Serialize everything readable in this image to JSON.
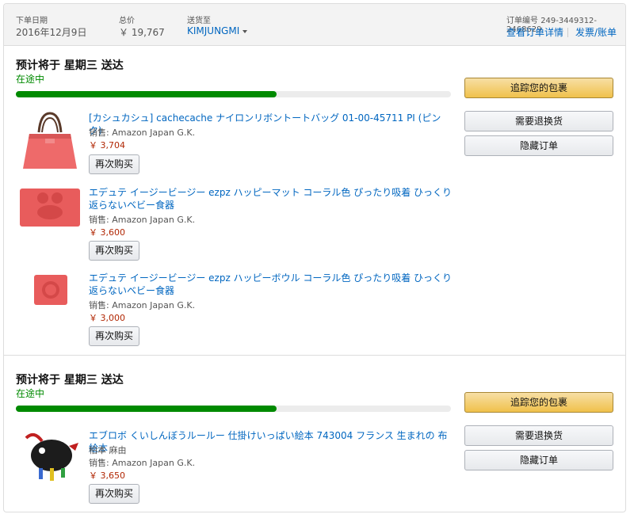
{
  "header": {
    "order_date_label": "下单日期",
    "order_date": "2016年12月9日",
    "total_label": "总价",
    "total": "￥ 19,767",
    "ship_to_label": "送货至",
    "ship_to": "KIMJUNGMI",
    "order_number_label": "订单编号",
    "order_number": "249-3449312-2468629",
    "view_details": "查看订单详情",
    "invoice": "发票/账单"
  },
  "shipments": [
    {
      "title": "预计将于 星期三 送达",
      "status": "在途中",
      "progress": 0.6,
      "track_button": "追踪您的包裹",
      "return_button": "需要退换货",
      "hide_button": "隐藏订单",
      "items": [
        {
          "title": "[カシュカシュ] cachecache ナイロンリボントートバッグ 01-00-45711 PI (ピンク)",
          "seller": "销售: Amazon Japan G.K.",
          "price": "￥ 3,704",
          "buy_again": "再次购买",
          "icon": "tote-bag-image"
        },
        {
          "title": "エデュテ イージービージー ezpz ハッピーマット コーラル色 ぴったり吸着 ひっくり返らないベビー食器",
          "seller": "销售: Amazon Japan G.K.",
          "price": "￥ 3,600",
          "buy_again": "再次购买",
          "icon": "happy-mat-image"
        },
        {
          "title": "エデュテ イージービージー ezpz ハッピーボウル コーラル色 ぴったり吸着 ひっくり返らないベビー食器",
          "seller": "销售: Amazon Japan G.K.",
          "price": "￥ 3,000",
          "buy_again": "再次购买",
          "icon": "happy-bowl-image"
        }
      ]
    },
    {
      "title": "预计将于 星期三 送达",
      "status": "在途中",
      "progress": 0.6,
      "track_button": "追踪您的包裹",
      "return_button": "需要退换货",
      "hide_button": "隐藏订单",
      "items": [
        {
          "title": "エブロボ くいしんぼうルールー 仕掛けいっぱい絵本 743004 フランス 生まれの 布絵本",
          "author": "柏本 麻由",
          "seller": "销售: Amazon Japan G.K.",
          "price": "￥ 3,650",
          "buy_again": "再次购买",
          "icon": "cloth-book-image"
        }
      ]
    }
  ],
  "colors": {
    "link": "#0066c0",
    "status_green": "#008a00",
    "price_red": "#b12704",
    "primary_button": "#f0c14b"
  }
}
